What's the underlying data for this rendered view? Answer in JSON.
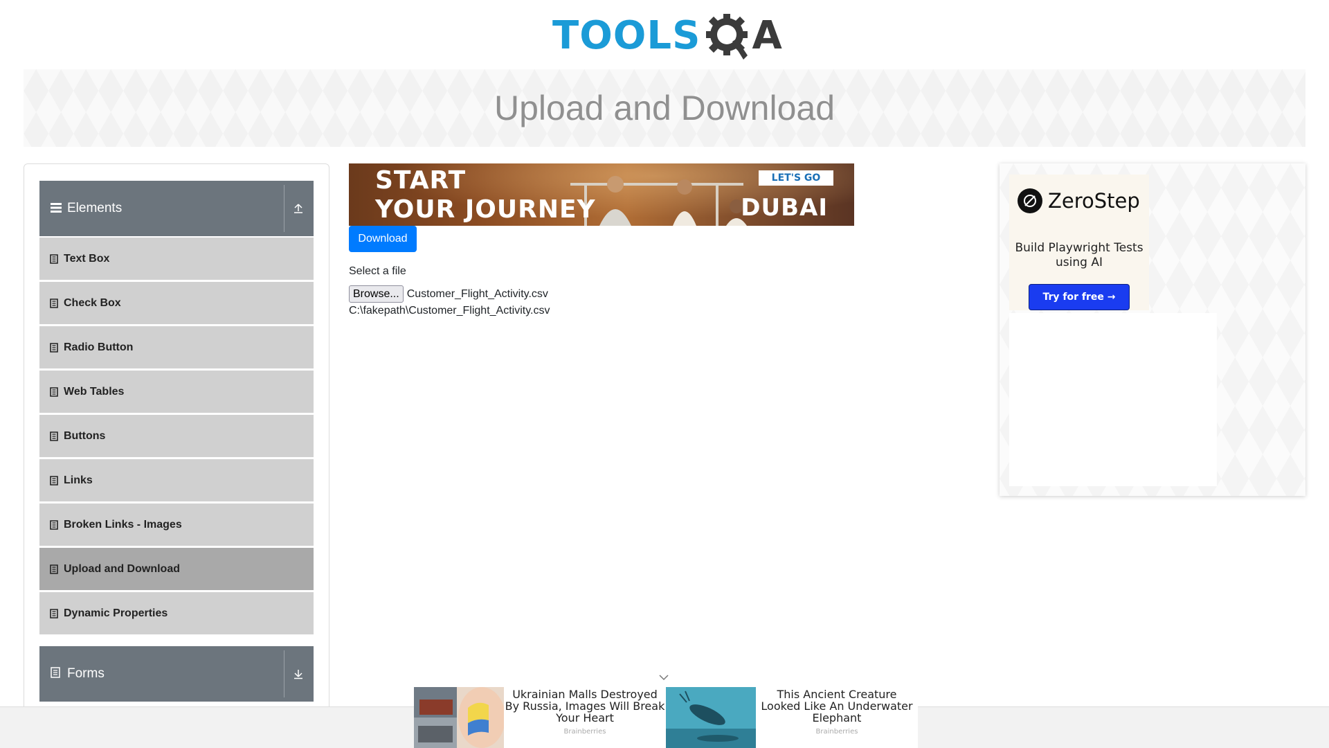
{
  "logo": {
    "text": "TOOLS",
    "suffix": "A"
  },
  "page_title": "Upload and Download",
  "sidebar": {
    "groups": [
      {
        "label": "Elements",
        "icon": "hamburger-icon",
        "toggle_icon": "collapse-up-icon"
      },
      {
        "label": "Forms",
        "icon": "document-icon",
        "toggle_icon": "expand-down-icon"
      }
    ],
    "items": [
      {
        "label": "Text Box"
      },
      {
        "label": "Check Box"
      },
      {
        "label": "Radio Button"
      },
      {
        "label": "Web Tables"
      },
      {
        "label": "Buttons"
      },
      {
        "label": "Links"
      },
      {
        "label": "Broken Links - Images"
      },
      {
        "label": "Upload and Download",
        "active": true
      },
      {
        "label": "Dynamic Properties"
      }
    ]
  },
  "ad_banner": {
    "line1": "START",
    "line2": "YOUR JOURNEY",
    "cta": "LET'S GO",
    "brand": "DUBAI"
  },
  "main": {
    "download_label": "Download",
    "select_label": "Select a file",
    "browse_label": "Browse...",
    "file_name": "Customer_Flight_Activity.csv",
    "uploaded_path": "C:\\fakepath\\Customer_Flight_Activity.csv"
  },
  "side_ad": {
    "brand": "ZeroStep",
    "tagline": "Build Playwright Tests using AI",
    "cta": "Try for free →"
  },
  "bottom_ads": [
    {
      "headline": "Ukrainian Malls Destroyed By Russia, Images Will Break Your Heart",
      "source": "Brainberries"
    },
    {
      "headline": "This Ancient Creature Looked Like An Underwater Elephant",
      "source": "Brainberries"
    }
  ],
  "colors": {
    "accent": "#007bff",
    "sidebar_header": "#6c757d",
    "menu_item": "#d0d0d0",
    "menu_item_active": "#a9a9a9",
    "logo_blue": "#1b9bd7"
  }
}
